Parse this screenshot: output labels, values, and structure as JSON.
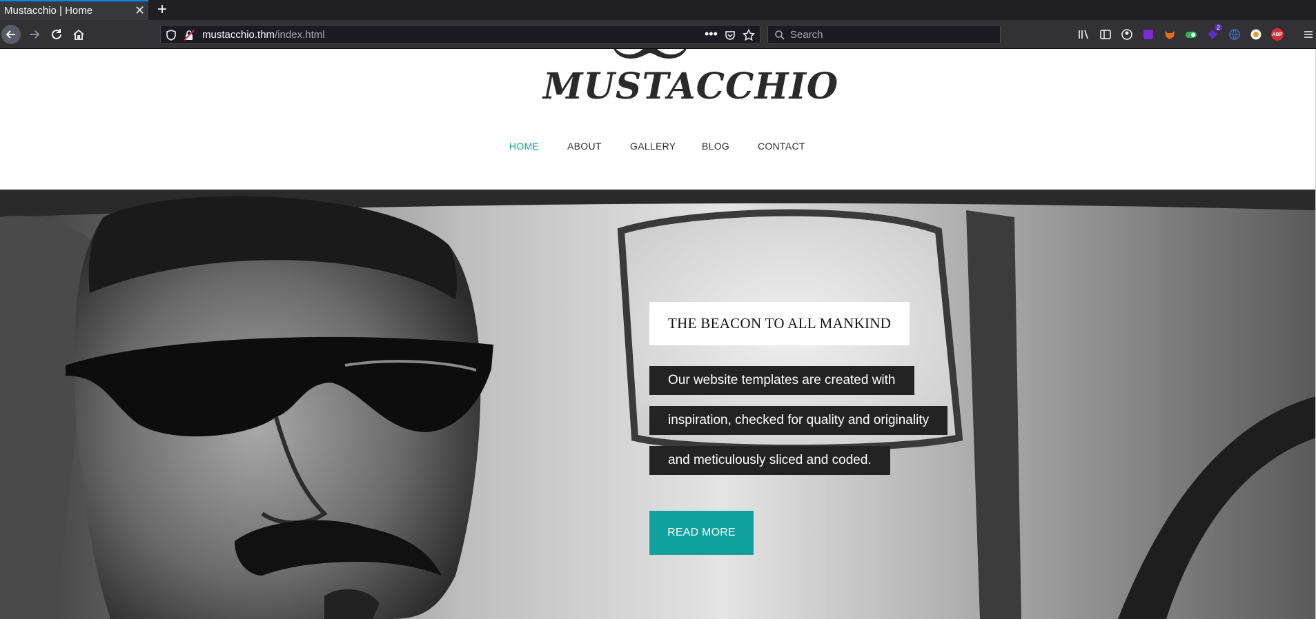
{
  "browser": {
    "tab_title": "Mustacchio | Home",
    "url_host": "mustacchio.thm",
    "url_path": "/index.html",
    "search_placeholder": "Search",
    "extension_badge": "2",
    "abp_label": "ABP"
  },
  "site": {
    "logo_text": "MUSTACCHIO",
    "nav": [
      {
        "label": "HOME",
        "active": true
      },
      {
        "label": "ABOUT"
      },
      {
        "label": "GALLERY"
      },
      {
        "label": "BLOG"
      },
      {
        "label": "CONTACT"
      }
    ]
  },
  "hero": {
    "heading": "THE BEACON TO ALL MANKIND",
    "lines": [
      "Our website templates are created with",
      "inspiration, checked for quality and originality",
      "and meticulously sliced and coded."
    ],
    "button_label": "READ MORE"
  },
  "colors": {
    "accent": "#0fa19e",
    "chrome_dark": "#202023",
    "text_dark": "#232323"
  }
}
